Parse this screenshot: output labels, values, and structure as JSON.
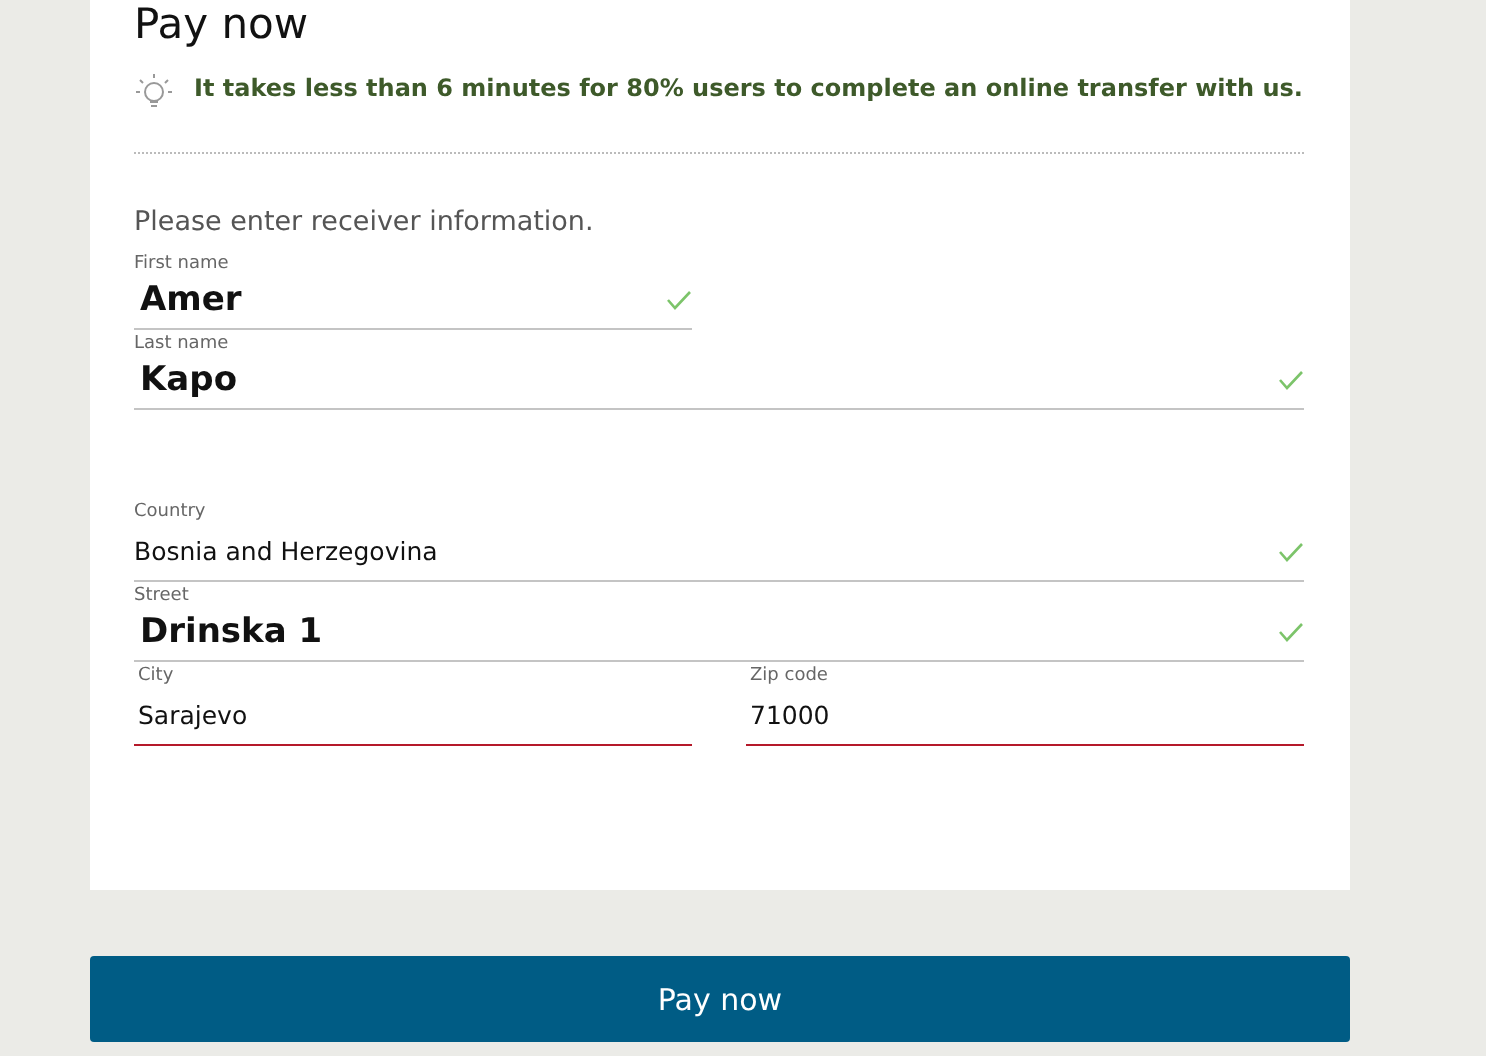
{
  "title": "Pay now",
  "tip": "It takes less than 6 minutes for 80% users to complete an online transfer with us.",
  "instruction": "Please enter receiver information.",
  "sections": [
    {
      "fields": [
        {
          "label": "First name",
          "value": "Amer",
          "kind": "large",
          "wide": false,
          "valid": true,
          "error": false
        },
        {
          "label": "Last name",
          "value": "Kapo",
          "kind": "large",
          "wide": true,
          "valid": true,
          "error": false
        }
      ]
    },
    {
      "fields": [
        {
          "label": "Country",
          "value": "Bosnia and Herzegovina",
          "kind": "plain",
          "wide": true,
          "valid": true,
          "error": false
        },
        {
          "label": "Street",
          "value": "Drinska 1",
          "kind": "large",
          "wide": true,
          "valid": true,
          "error": false
        },
        {
          "label": "City",
          "value": "Sarajevo",
          "kind": "plain",
          "wide": false,
          "valid": false,
          "error": true
        },
        {
          "label": "Zip code",
          "value": "71000",
          "kind": "plain",
          "wide": false,
          "valid": false,
          "error": true
        }
      ]
    }
  ],
  "submit": "Pay now"
}
